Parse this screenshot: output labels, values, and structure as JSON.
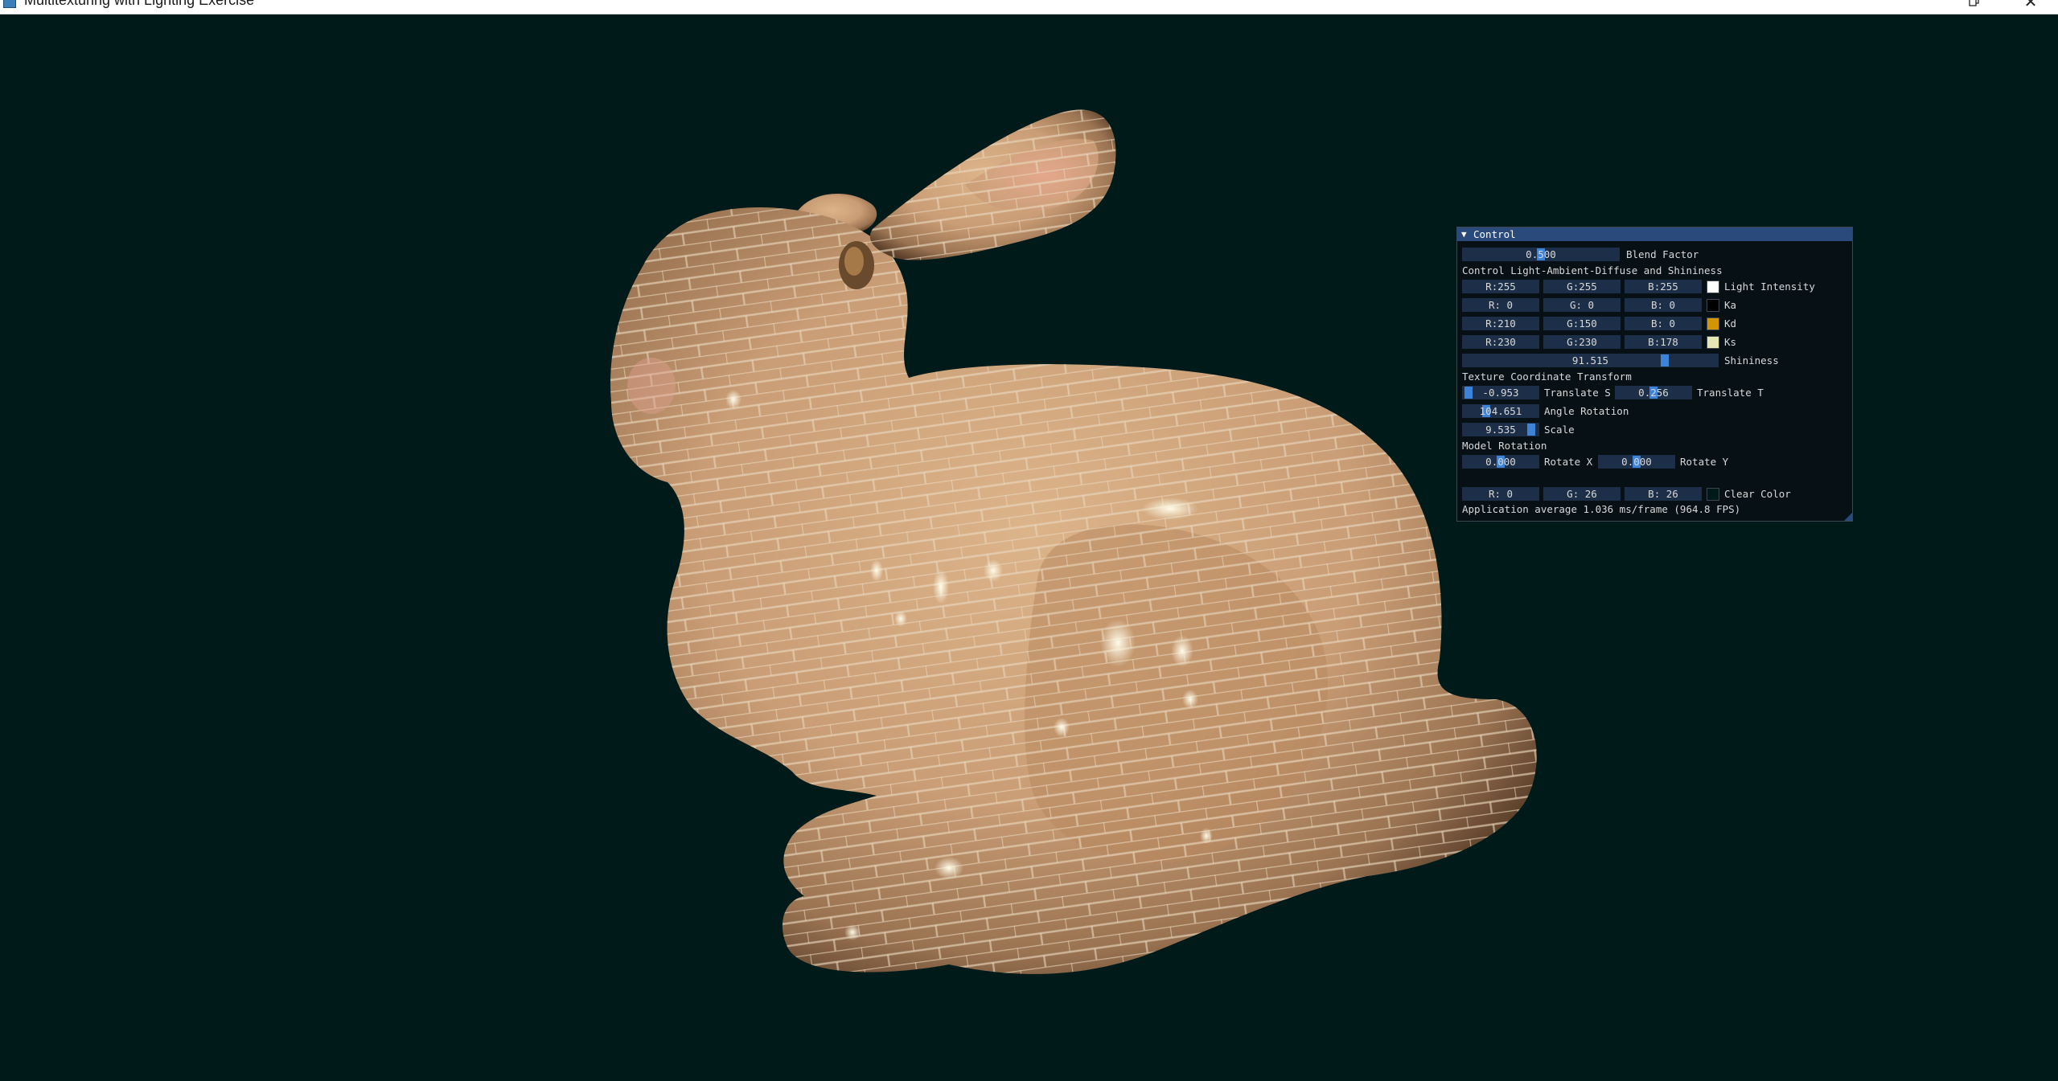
{
  "window": {
    "title": "Multitexturing with Lighting Exercise",
    "restore_icon": "restore-icon",
    "close_symbol": "✕"
  },
  "scene": {
    "background": "#001a1a",
    "model_color": "#c99d75",
    "mortar_color": "#e6d4bc"
  },
  "panel": {
    "title": "Control",
    "collapse_arrow": "▼",
    "blend": {
      "value": "0.500",
      "level": 0.5,
      "label": "Blend Factor"
    },
    "lighting_header": "Control Light-Ambient-Diffuse and Shininess",
    "colors": [
      {
        "r": "R:255",
        "g": "G:255",
        "b": "B:255",
        "swatch": "#ffffff",
        "label": "Light Intensity"
      },
      {
        "r": "R:  0",
        "g": "G:  0",
        "b": "B:  0",
        "swatch": "#000000",
        "label": "Ka"
      },
      {
        "r": "R:210",
        "g": "G:150",
        "b": "B:  0",
        "swatch": "#d29600",
        "label": "Kd"
      },
      {
        "r": "R:230",
        "g": "G:230",
        "b": "B:178",
        "swatch": "#e6e6b2",
        "label": "Ks"
      }
    ],
    "shininess": {
      "value": "91.515",
      "level": 0.8,
      "label": "Shininess"
    },
    "texture_header": "Texture Coordinate Transform",
    "translate_s": {
      "value": "-0.953",
      "level": 0.02,
      "label": "Translate S"
    },
    "translate_t": {
      "value": "0.256",
      "level": 0.5,
      "label": "Translate T"
    },
    "angle": {
      "value": "104.651",
      "level": 0.29,
      "label": "Angle Rotation"
    },
    "scale": {
      "value": "9.535",
      "level": 0.95,
      "label": "Scale"
    },
    "model_header": "Model Rotation",
    "rotate_x": {
      "value": "0.000",
      "level": 0.5,
      "label": "Rotate X"
    },
    "rotate_y": {
      "value": "0.000",
      "level": 0.5,
      "label": "Rotate Y"
    },
    "clear": {
      "r": "R:  0",
      "g": "G: 26",
      "b": "B: 26",
      "swatch": "#001a1a",
      "label": "Clear Color"
    },
    "stats": "Application average 1.036 ms/frame (964.8 FPS)",
    "accent": "#3d83d8"
  }
}
